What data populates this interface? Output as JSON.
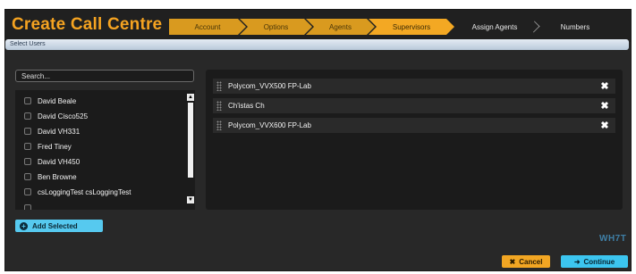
{
  "app": {
    "title": "Create Call Centre"
  },
  "wizard_steps": [
    {
      "label": "Account",
      "state": "done"
    },
    {
      "label": "Options",
      "state": "done"
    },
    {
      "label": "Agents",
      "state": "done"
    },
    {
      "label": "Supervisors",
      "state": "current"
    },
    {
      "label": "Assign Agents",
      "state": "todo"
    },
    {
      "label": "Numbers",
      "state": "todo"
    }
  ],
  "section": {
    "title": "Select Users"
  },
  "search": {
    "placeholder": "Search..."
  },
  "users": [
    "David Beale",
    "David Cisco525",
    "David VH331",
    "Fred Tiney",
    "David VH450",
    "Ben Browne",
    "csLoggingTest csLoggingTest",
    "....  ...."
  ],
  "selected_users": [
    "Polycom_VVX500 FP-Lab",
    "Ch'istas Ch",
    "Polycom_VVX600 FP-Lab"
  ],
  "buttons": {
    "add_selected": "Add Selected",
    "cancel": "Cancel",
    "continue": "Continue"
  },
  "logo": {
    "text": "WH7T"
  },
  "colors": {
    "brand_orange": "#f5a321",
    "accent_blue": "#56c9ef",
    "background": "#282828"
  }
}
